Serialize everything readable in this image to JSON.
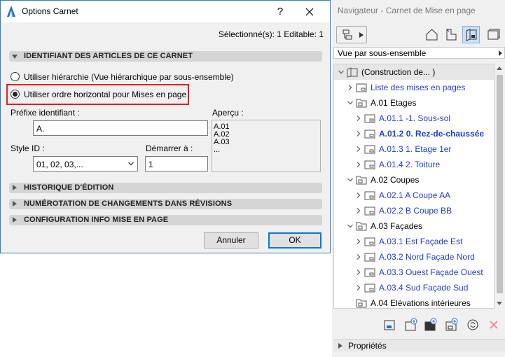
{
  "dialog": {
    "title": "Options Carnet",
    "help_label": "?",
    "selection_status": "Sélectionné(s): 1 Editable: 1",
    "section_identifiers": "IDENTIFIANT DES ARTICLES DE CE CARNET",
    "radio_hierarchy": "Utiliser hiérarchie (Vue hiérarchique par sous-ensemble)",
    "radio_horizontal": "Utiliser ordre horizontal pour Mises en page",
    "prefix_label": "Préfixe identifiant :",
    "prefix_value": "A.",
    "preview_label": "Aperçu :",
    "preview_lines": [
      "A.01",
      "A.02",
      "A.03",
      "..."
    ],
    "style_label": "Style ID :",
    "style_value": "01, 02, 03,...",
    "start_label": "Démarrer à :",
    "start_value": "1",
    "section_history": "HISTORIQUE D'ÉDITION",
    "section_revision": "NUMÉROTATION DE CHANGEMENTS DANS RÉVISIONS",
    "section_config": "CONFIGURATION INFO MISE EN PAGE",
    "cancel_label": "Annuler",
    "ok_label": "OK",
    "highlight_color": "#e02020"
  },
  "navigator": {
    "title": "Navigateur - Carnet de Mise en page",
    "view_select": "Vue par sous-ensemble",
    "tree": [
      {
        "label": "(Construction de... )",
        "icon": "book-icon"
      },
      {
        "label": "Liste des mises en pages",
        "icon": "layout-icon"
      },
      {
        "label": "A.01 Etages",
        "icon": "folder-icon"
      },
      {
        "label": "A.01.1 -1. Sous-sol",
        "icon": "layout-icon"
      },
      {
        "label": "A.01.2 0. Rez-de-chaussée",
        "icon": "layout-icon"
      },
      {
        "label": "A.01.3 1. Etage 1er",
        "icon": "layout-icon"
      },
      {
        "label": "A.01.4 2. Toiture",
        "icon": "layout-icon"
      },
      {
        "label": "A.02 Coupes",
        "icon": "folder-icon"
      },
      {
        "label": "A.02.1 A Coupe AA",
        "icon": "layout-icon"
      },
      {
        "label": "A.02.2 B Coupe BB",
        "icon": "layout-icon"
      },
      {
        "label": "A.03 Façades",
        "icon": "folder-icon"
      },
      {
        "label": "A.03.1 Est Façade Est",
        "icon": "layout-icon"
      },
      {
        "label": "A.03.2 Nord Façade Nord",
        "icon": "layout-icon"
      },
      {
        "label": "A.03.3 Ouest Façade Ouest",
        "icon": "layout-icon"
      },
      {
        "label": "A.03.4 Sud Façade Sud",
        "icon": "layout-icon"
      },
      {
        "label": "A.04 Elévations intérieures",
        "icon": "folder-icon"
      }
    ],
    "footer_label": "Propriétés"
  }
}
